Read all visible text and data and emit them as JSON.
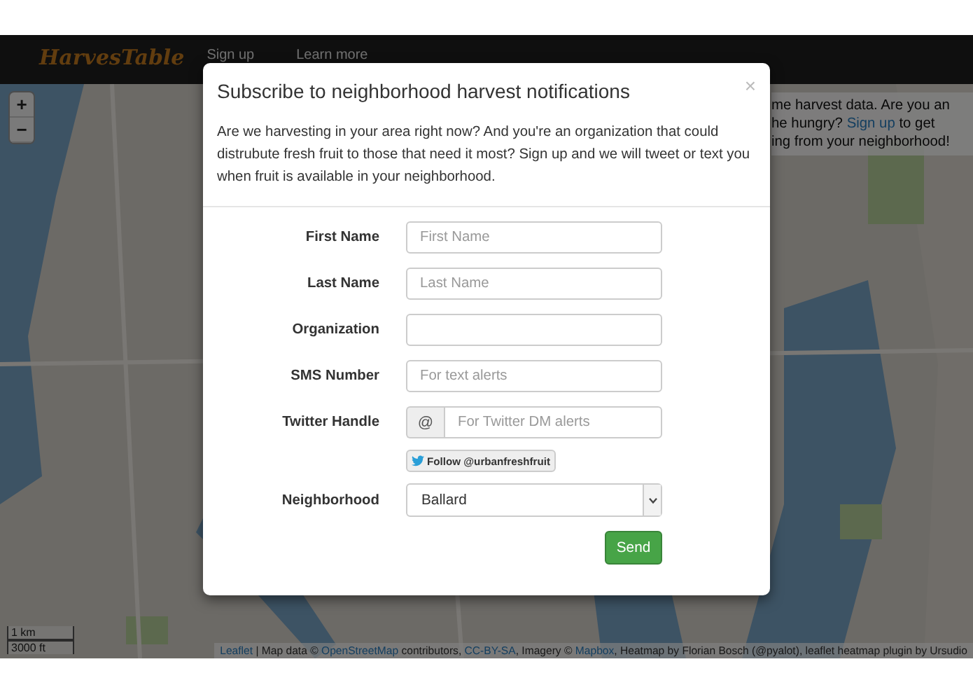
{
  "navbar": {
    "logo": "HarvesTable",
    "links": [
      "Sign up",
      "Learn more"
    ]
  },
  "map": {
    "zoom_buttons": [
      "+",
      "−"
    ],
    "info_lines": [
      [
        {
          "kind": "text",
          "text": "me harvest data. Are you an"
        }
      ],
      [
        {
          "kind": "text",
          "text": "he hungry? "
        },
        {
          "kind": "link",
          "text": "Sign up"
        },
        {
          "kind": "text",
          "text": " to get"
        }
      ],
      [
        {
          "kind": "text",
          "text": "ing from your neighborhood!"
        }
      ]
    ],
    "scale": [
      "1 km",
      "3000 ft"
    ],
    "attribution": [
      {
        "kind": "link",
        "text": "Leaflet"
      },
      {
        "kind": "text",
        "text": " | Map data © "
      },
      {
        "kind": "link",
        "text": "OpenStreetMap"
      },
      {
        "kind": "text",
        "text": " contributors, "
      },
      {
        "kind": "link",
        "text": "CC-BY-SA"
      },
      {
        "kind": "text",
        "text": ", Imagery © "
      },
      {
        "kind": "link",
        "text": "Mapbox"
      },
      {
        "kind": "text",
        "text": ", Heatmap by Florian Bosch (@pyalot), leaflet heatmap plugin by Ursudio"
      }
    ]
  },
  "modal": {
    "title": "Subscribe to neighborhood harvest notifications",
    "close": "×",
    "description": "Are we harvesting in your area right now? And you're an organization that could distrubute fresh fruit to those that need it most? Sign up and we will tweet or text you when fruit is available in your neighborhood.",
    "fields": [
      {
        "kind": "text",
        "label": "First Name",
        "placeholder": "First Name"
      },
      {
        "kind": "text",
        "label": "Last Name",
        "placeholder": "Last Name"
      },
      {
        "kind": "text",
        "label": "Organization"
      },
      {
        "kind": "text",
        "label": "SMS Number",
        "placeholder": "For text alerts"
      },
      {
        "kind": "addon",
        "label": "Twitter Handle",
        "addon": "@",
        "placeholder": "For Twitter DM alerts"
      },
      {
        "kind": "follow",
        "text": "Follow @urbanfreshfruit"
      },
      {
        "kind": "select",
        "label": "Neighborhood",
        "value": "Ballard"
      }
    ],
    "submit": "Send"
  }
}
